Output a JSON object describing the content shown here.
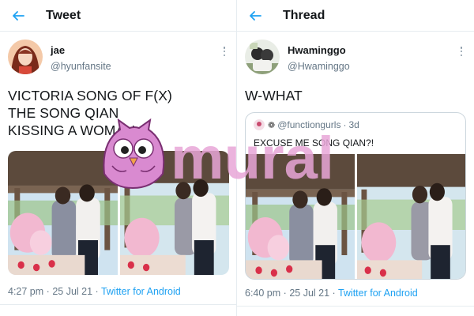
{
  "left_panel": {
    "header": {
      "title": "Tweet"
    },
    "author": {
      "name": "jae",
      "handle": "@hyunfansite"
    },
    "text_lines": [
      "VICTORIA SONG OF F(X)",
      "THE SONG QIAN",
      "KISSING A WOMAN"
    ],
    "meta": {
      "time": "4:27 pm",
      "date": "25 Jul 21",
      "separator": "·",
      "client": "Twitter for Android"
    }
  },
  "right_panel": {
    "header": {
      "title": "Thread"
    },
    "author": {
      "name": "Hwaminggo",
      "handle": "@Hwaminggo"
    },
    "text_lines": [
      "W-WHAT"
    ],
    "quoted_tweet": {
      "handle": "@functiongurls",
      "separator": "·",
      "age": "3d",
      "text": "EXCUSE ME SONG QIAN?!"
    },
    "meta": {
      "time": "6:40 pm",
      "date": "25 Jul 21",
      "separator": "·",
      "client": "Twitter for Android"
    }
  },
  "watermark": {
    "text": "mural"
  },
  "colors": {
    "accent": "#1da1f2",
    "secondary_text": "#657786",
    "border": "#e6ecf0",
    "watermark_pink": "#e8a6d8"
  },
  "icons": [
    "back-arrow-icon",
    "more-options-icon",
    "owl-mascot-icon"
  ]
}
